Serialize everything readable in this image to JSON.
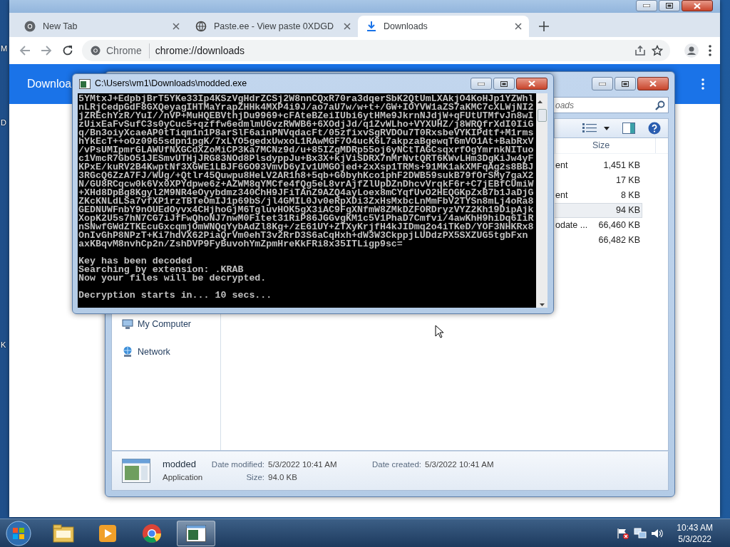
{
  "desktop": {
    "icon_labels": [
      "M",
      "D",
      "K"
    ]
  },
  "browser": {
    "tabs": [
      {
        "title": "New Tab",
        "kind": "chrome",
        "selected": false
      },
      {
        "title": "Paste.ee - View paste 0XDGD",
        "kind": "paste",
        "selected": false
      },
      {
        "title": "Downloads",
        "kind": "download",
        "selected": true
      }
    ],
    "chip": "Chrome",
    "url": "chrome://downloads",
    "page_title": "Downloa"
  },
  "explorer": {
    "search": {
      "placeholder": "oads"
    },
    "columns": [
      "Size"
    ],
    "files": [
      {
        "column_2": "ent",
        "size": "1,451 KB",
        "selected": false
      },
      {
        "size": "17 KB",
        "selected": false
      },
      {
        "column_2": "ent",
        "size": "8 KB",
        "selected": false
      },
      {
        "size": "94 KB",
        "selected": true
      },
      {
        "column_2": "odate ...",
        "size": "66,460 KB",
        "selected": false
      },
      {
        "size": "66,482 KB",
        "selected": false
      }
    ],
    "nav": [
      {
        "label": "My Computer",
        "kind": "computer"
      },
      {
        "label": "Network",
        "kind": "network"
      }
    ],
    "details": {
      "name": "modded",
      "type": "Application",
      "modified_label": "Date modified:",
      "modified": "5/3/2022 10:41 AM",
      "size_label": "Size:",
      "size": "94.0 KB",
      "created_label": "Date created:",
      "created": "5/3/2022 10:41 AM"
    }
  },
  "console": {
    "title": "C:\\Users\\vm1\\Downloads\\modded.exe",
    "blocks": [
      [
        "5YMtxJ+EdpbjBrT5YKe33Ip4KSzVgHdrZCSj2W8nnCQxR70ra3dqerSbK2QtUmLXAkjO4KoHJp1YZWhl",
        "nLRjCedpGdF8GXQeyagIHTMaYrapZHHk4MXP4i9J/ao7aU7w/w+t+/GW+IOYVW1aZS7aKMC7cXLWjNI2",
        "jZREchYzR/YuI//nVP+MuHQEBVthjDu9969+cFAteBZeiIUbi6ytHMe9JkrnNJdjW+qFUtUTMfvJn8wI",
        "zUixEaFvSufC3s0yCuc5+qzffw6edmlmUGvzRWWB6+6XOdjJd/q1ZvWLho+VYXUHZ/j8WRQfrXdI0IiG",
        "q/Bn3oiyXcaeAP0tTiqm1n1P8arSlF6ainPNVqdacFt/05zfixvSgRVDOu7T0RxsbeVYKIPdtf+M1rms",
        "hYkEcT++oOz0965sdpn1pgK/7xLYO5gedxUwxoL1RAwMGF7O4ucK6L7akpzaBgewqT6mVO1At+BabRxV",
        "/vPsUMIpmrGLAWUfNXGCdXZoMiCP3Ka7MCNz9d/u+85IZgMDRp55oj6yNCtTAGCsqxrfOgYmrnkNITuo",
        "c1VmcR7GbO51JESmvUTHjJRG83NOd8PlsdyppJu+Bx3X+kjViSDRX7nMrNvtQRT6KWvLHm3DgKiJw4yF",
        "KPxE/kuRV2B4KwptNf3XGWE1LBJF6GO93VmvD6yIv1UMGOjed+2xXsp1TRMs+91MK1akXMFqAg2s8BBJ",
        "3RGcQ6ZzA7FJ/WUg/+Qtlr45Quwpu8HeLV2AR1h8+5qb+G0byhKco1phF2DWB59sukB79fOrSMy7gaX2",
        "N/GU8RCqcw0k6Vx0XPYdpwe6z+AZWM8qYMCfe4fQg5eL8vrAjfZlUpDZnDhcvVrqkF6r+C7jEBfCUmiW",
        "+XHd8DpBg8Kgyl2M9NR4eOyybdmz340ChH9JFiTAnZ9AZQ4ayLoex8mCYqfUvO2HEQGKpZxB7b1JaDjG",
        "ZKcKNLdLSa7vfXP1rzTBTeOmIJ1p69bS/jl4GMIL0Jv0eRpXDi3ZxHsMxbcLnMmFbV2TYSn8mLj4oRa8",
        "GEDNUWFnbY9nOUEdOyvx4CHjhoGjM6TgluvHOK5gX3iAC9FgXNfmW8ZMkDZFORDryzVYZ2Kh19DipAjk",
        "XopK2U5s7hN7CG7iJfFwQhoNJ7nwM0Fitet31RiP86JGGvgKM1c5V1PhaD7Cmfvi/4awKhH9hiDq6IiR",
        "nSNwfGWdZTKEcuGxcqmjOmWNQqYybAdZl8Kg+/zE61UY+ZTXyKrjfH4kJIDmq2o4iTKeD/YOF3NHKRx8",
        "OnIvGhP8NPzT+Ki7hdVX62PiaQrVm0ehT3v2RrD3S6aCqHxh+dW3W3CkppjLUDdzPX5SXZUG5tgbFxn",
        "axKBqvM8nvhCp2n/ZshDVP9FyBuvohYmZpmHreKkFRi8x35ITLigp9sc="
      ],
      [
        "Key has been decoded",
        "Searching by extension: .KRAB",
        "Now your files will be decrypted."
      ],
      [
        "Decryption starts in... 10 secs..."
      ]
    ]
  },
  "taskbar": {
    "apps": [
      {
        "kind": "explorer",
        "selected": false
      },
      {
        "kind": "media",
        "selected": false
      },
      {
        "kind": "chrome",
        "selected": false
      },
      {
        "kind": "console",
        "selected": true
      }
    ],
    "time": "10:43 AM",
    "date": "5/3/2022"
  }
}
